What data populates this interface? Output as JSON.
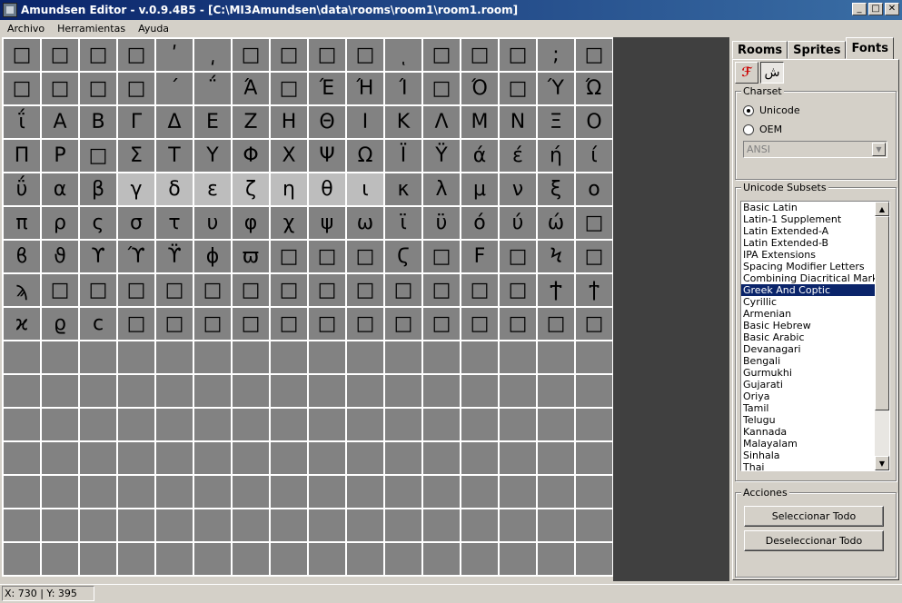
{
  "window": {
    "title": "Amundsen Editor - v.0.9.4B5 - [C:\\MI3Amundsen\\data\\rooms\\room1\\room1.room]",
    "controls": [
      "_",
      "□",
      "✕"
    ]
  },
  "menu": [
    "Archivo",
    "Herramientas",
    "Ayuda"
  ],
  "glyph_rows": [
    [
      "□",
      "□",
      "□",
      "□",
      "ʹ",
      "͵",
      "□",
      "□",
      "□",
      "□",
      "ͺ",
      "□",
      "□",
      "□",
      ";",
      "□"
    ],
    [
      "□",
      "□",
      "□",
      "□",
      "΄",
      "΅",
      "Ά",
      "□",
      "Έ",
      "Ή",
      "Ί",
      "□",
      "Ό",
      "□",
      "Ύ",
      "Ώ"
    ],
    [
      "ΐ",
      "Α",
      "Β",
      "Γ",
      "Δ",
      "Ε",
      "Ζ",
      "Η",
      "Θ",
      "Ι",
      "Κ",
      "Λ",
      "Μ",
      "Ν",
      "Ξ",
      "Ο"
    ],
    [
      "Π",
      "Ρ",
      "□",
      "Σ",
      "Τ",
      "Υ",
      "Φ",
      "Χ",
      "Ψ",
      "Ω",
      "Ϊ",
      "Ϋ",
      "ά",
      "έ",
      "ή",
      "ί"
    ],
    [
      "ΰ",
      "α",
      "β",
      "γ",
      "δ",
      "ε",
      "ζ",
      "η",
      "θ",
      "ι",
      "κ",
      "λ",
      "μ",
      "ν",
      "ξ",
      "ο"
    ],
    [
      "π",
      "ρ",
      "ς",
      "σ",
      "τ",
      "υ",
      "φ",
      "χ",
      "ψ",
      "ω",
      "ϊ",
      "ϋ",
      "ό",
      "ύ",
      "ώ",
      "□"
    ],
    [
      "ϐ",
      "ϑ",
      "ϒ",
      "ϓ",
      "ϔ",
      "ϕ",
      "ϖ",
      "□",
      "□",
      "□",
      "Ϛ",
      "□",
      "Ϝ",
      "□",
      "Ϟ",
      "□"
    ],
    [
      "ϡ",
      "□",
      "□",
      "□",
      "□",
      "□",
      "□",
      "□",
      "□",
      "□",
      "□",
      "□",
      "□",
      "□",
      "Ϯ",
      "ϯ"
    ],
    [
      "ϰ",
      "ϱ",
      "ϲ",
      "□",
      "□",
      "□",
      "□",
      "□",
      "□",
      "□",
      "□",
      "□",
      "□",
      "□",
      "□",
      "□"
    ]
  ],
  "selected_cells": [
    [
      4,
      3
    ],
    [
      4,
      4
    ],
    [
      4,
      5
    ],
    [
      4,
      6
    ],
    [
      4,
      7
    ],
    [
      4,
      8
    ],
    [
      4,
      9
    ]
  ],
  "total_rows": 16,
  "tabs": [
    {
      "label": "Rooms",
      "active": false
    },
    {
      "label": "Sprites",
      "active": false
    },
    {
      "label": "Fonts",
      "active": true
    }
  ],
  "tool_buttons": [
    {
      "icon": "font-tool-icon",
      "glyph": "ℱ"
    },
    {
      "icon": "arabic-glyph-icon",
      "glyph": "ش",
      "pressed": true
    }
  ],
  "charset": {
    "legend": "Charset",
    "options": [
      {
        "label": "Unicode",
        "selected": true
      },
      {
        "label": "OEM",
        "selected": false
      }
    ],
    "combo_value": "ANSI"
  },
  "subsets": {
    "legend": "Unicode Subsets",
    "items": [
      "Basic Latin",
      "Latin-1 Supplement",
      "Latin Extended-A",
      "Latin Extended-B",
      "IPA Extensions",
      "Spacing Modifier Letters",
      "Combining Diacritical Marks",
      "Greek And Coptic",
      "Cyrillic",
      "Armenian",
      "Basic Hebrew",
      "Basic Arabic",
      "Devanagari",
      "Bengali",
      "Gurmukhi",
      "Gujarati",
      "Oriya",
      "Tamil",
      "Telugu",
      "Kannada",
      "Malayalam",
      "Sinhala",
      "Thai"
    ],
    "selected_index": 7
  },
  "actions": {
    "legend": "Acciones",
    "select_all": "Seleccionar Todo",
    "deselect_all": "Deseleccionar Todo"
  },
  "status": {
    "coords": "X: 730 | Y: 395"
  }
}
